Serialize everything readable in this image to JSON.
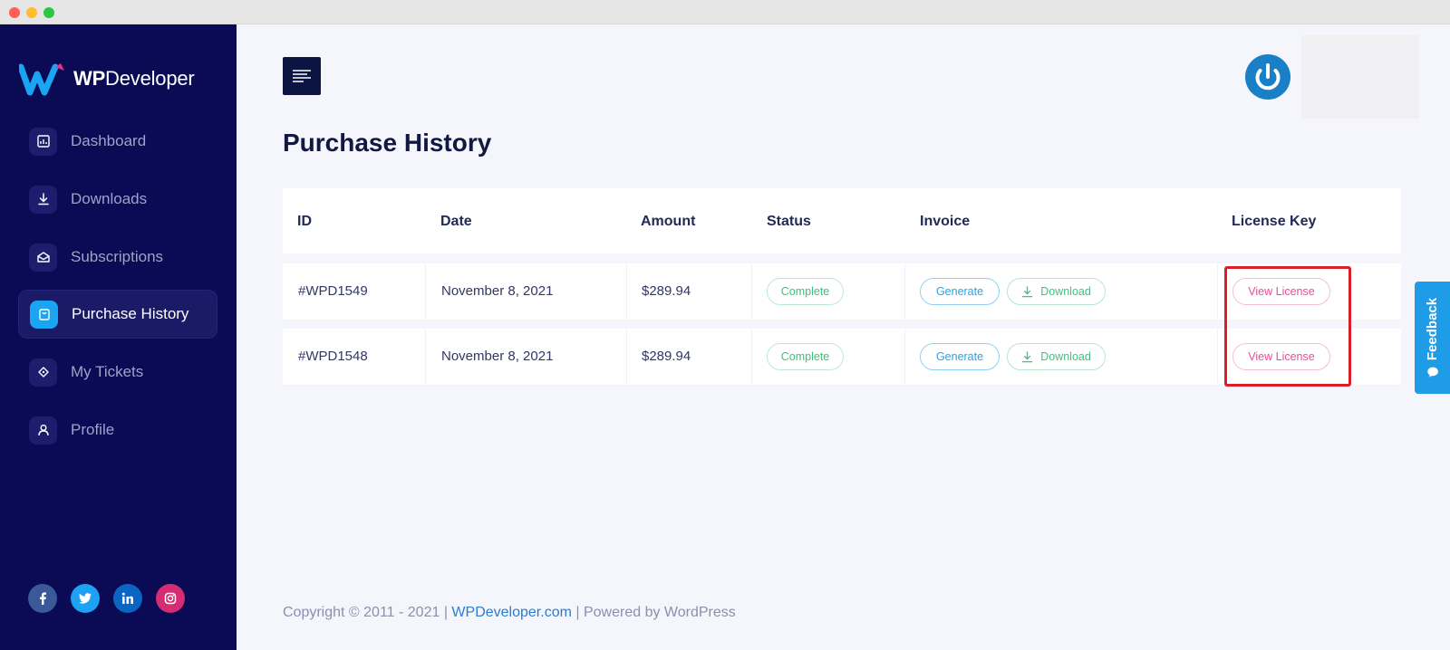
{
  "brand": {
    "name_bold": "WP",
    "name_rest": "Developer"
  },
  "sidebar": {
    "items": [
      {
        "label": "Dashboard",
        "icon": "dashboard-icon",
        "active": false
      },
      {
        "label": "Downloads",
        "icon": "download-icon",
        "active": false
      },
      {
        "label": "Subscriptions",
        "icon": "envelope-icon",
        "active": false
      },
      {
        "label": "Purchase History",
        "icon": "bag-icon",
        "active": true
      },
      {
        "label": "My Tickets",
        "icon": "ticket-icon",
        "active": false
      },
      {
        "label": "Profile",
        "icon": "user-icon",
        "active": false
      }
    ],
    "social": [
      "facebook-icon",
      "twitter-icon",
      "linkedin-icon",
      "instagram-icon"
    ]
  },
  "page": {
    "title": "Purchase History"
  },
  "table": {
    "headers": [
      "ID",
      "Date",
      "Amount",
      "Status",
      "Invoice",
      "License Key"
    ],
    "rows": [
      {
        "id": "#WPD1549",
        "date": "November 8, 2021",
        "amount": "$289.94",
        "status": "Complete",
        "generate": "Generate",
        "download": "Download",
        "license": "View License"
      },
      {
        "id": "#WPD1548",
        "date": "November 8, 2021",
        "amount": "$289.94",
        "status": "Complete",
        "generate": "Generate",
        "download": "Download",
        "license": "View License"
      }
    ]
  },
  "feedback": {
    "label": "Feedback"
  },
  "footer": {
    "prefix": "Copyright © 2011 - 2021 | ",
    "link": "WPDeveloper.com",
    "suffix": " | Powered by WordPress"
  },
  "colors": {
    "sidebar_bg": "#0a0a55",
    "accent": "#1ba4f2",
    "complete": "#3ac27a",
    "license": "#ea4e9a",
    "highlight": "#db1f2a"
  }
}
